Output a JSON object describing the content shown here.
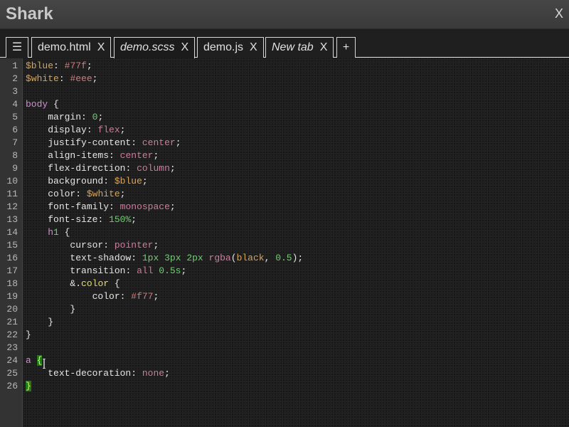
{
  "app": {
    "title": "Shark",
    "close_label": "X"
  },
  "tabs": {
    "menu_icon": "☰",
    "items": [
      {
        "label": "demo.html",
        "close": "X"
      },
      {
        "label": "demo.scss",
        "close": "X"
      },
      {
        "label": "demo.js",
        "close": "X"
      },
      {
        "label": "New tab",
        "close": "X"
      }
    ],
    "add_label": "+"
  },
  "editor": {
    "line_numbers": [
      "1",
      "2",
      "3",
      "4",
      "5",
      "6",
      "7",
      "8",
      "9",
      "10",
      "11",
      "12",
      "13",
      "14",
      "15",
      "16",
      "17",
      "18",
      "19",
      "20",
      "21",
      "22",
      "23",
      "24",
      "25",
      "26"
    ],
    "lines": [
      "$blue: #77f;",
      "$white: #eee;",
      "",
      "body {",
      "    margin: 0;",
      "    display: flex;",
      "    justify-content: center;",
      "    align-items: center;",
      "    flex-direction: column;",
      "    background: $blue;",
      "    color: $white;",
      "    font-family: monospace;",
      "    font-size: 150%;",
      "    h1 {",
      "        cursor: pointer;",
      "        text-shadow: 1px 3px 2px rgba(black, 0.5);",
      "        transition: all 0.5s;",
      "        &.color {",
      "            color: #f77;",
      "        }",
      "    }",
      "}",
      "",
      "a {",
      "    text-decoration: none;",
      "}"
    ],
    "active_tab": "demo.scss"
  }
}
